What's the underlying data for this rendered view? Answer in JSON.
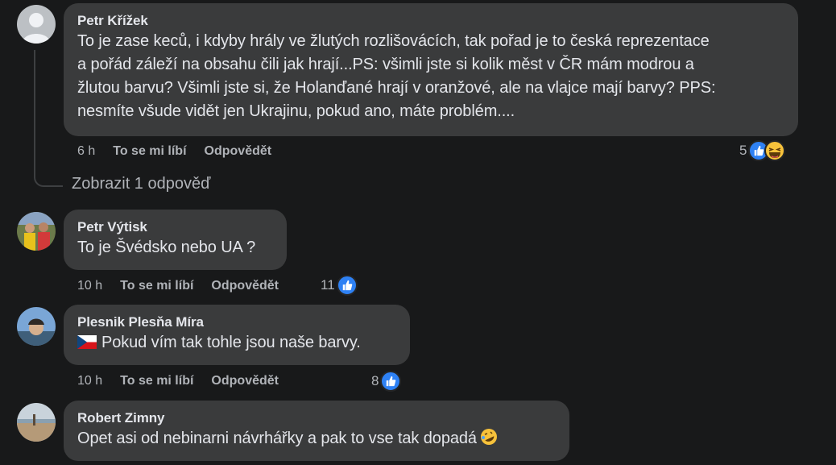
{
  "comments": [
    {
      "author": "Petr Křížek",
      "lines": [
        "To je zase keců, i kdyby hrály ve žlutých rozlišovácích, tak pořad je to česká reprezentace",
        "a pořád záleží na obsahu čili jak hrají...PS: všimli jste si kolik měst v ČR mám modrou a",
        "žlutou barvu? Všimli jste si, že Holanďané hrají v oranžové, ale na vlajce mají barvy? PPS:",
        "nesmíte všude vidět jen Ukrajinu, pokud ano, máte problém...."
      ],
      "time": "6 h",
      "like_label": "To se mi líbí",
      "reply_label": "Odpovědět",
      "reaction_count": "5",
      "reactions": [
        "like-icon",
        "haha-icon"
      ],
      "avatar": "default-avatar"
    },
    {
      "author": "Petr Výtisk",
      "lines": [
        "To je Švédsko nebo UA ?"
      ],
      "time": "10 h",
      "like_label": "To se mi líbí",
      "reply_label": "Odpovědět",
      "reaction_count": "11",
      "reactions": [
        "like-icon"
      ],
      "avatar": "photo-avatar"
    },
    {
      "author": "Plesnik Plesňa Míra",
      "lines": [
        "Pokud vím tak tohle jsou naše barvy."
      ],
      "flag": "czech-flag-icon",
      "time": "10 h",
      "like_label": "To se mi líbí",
      "reply_label": "Odpovědět",
      "reaction_count": "8",
      "reactions": [
        "like-icon"
      ],
      "avatar": "photo-avatar"
    },
    {
      "author": "Robert Zimny",
      "lines": [
        "Opet asi od nebinarni návrhářky a pak to vse tak dopadá"
      ],
      "trailing_emoji": "rolling-laughing-emoji",
      "avatar": "photo-avatar"
    }
  ],
  "view_replies": "Zobrazit 1 odpověď",
  "colors": {
    "background": "#18191a",
    "bubble": "#3a3b3c",
    "text": "#e4e6eb",
    "secondary": "#b0b3b8",
    "like_blue": "#2e81f4"
  }
}
